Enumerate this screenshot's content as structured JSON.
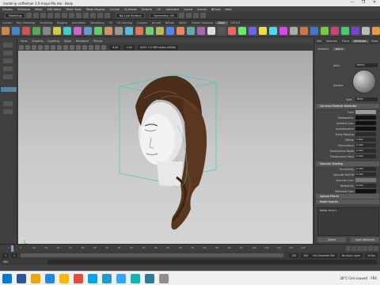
{
  "window": {
    "title": "model-ip coffeehair 2.0 maya file.mb - Body",
    "controls": [
      "—",
      "❐",
      "✕"
    ]
  },
  "menubar": [
    "Display",
    "Windows",
    "Mesh",
    "Edit Mesh",
    "Mesh Tools",
    "Mesh Display",
    "Curves",
    "Surfaces",
    "Deform",
    "UV",
    "Generate",
    "Cache",
    "Arnold",
    "Bifrost",
    "Help"
  ],
  "statusline": {
    "mode": "Modeling",
    "live_surface": "No Live Surface",
    "symmetry": "Symmetry: Off"
  },
  "shelf_tabs": [
    "Curves",
    "Poly Modeling",
    "Sculpting",
    "Rigging",
    "Animation",
    "Rendering",
    "FX",
    "FX Caching",
    "Custom",
    "Arnold",
    "Bifrost",
    "MASH",
    "Motion Graphics",
    "XGen",
    "TURTLE"
  ],
  "shelf_active": "XGen",
  "viewport": {
    "menu": [
      "View",
      "Shading",
      "Lighting",
      "Show",
      "Renderer",
      "Panels"
    ],
    "gamma": "sRGB gamma",
    "exposure": "0.00",
    "gamma_val": "1.00",
    "camera_label": "ACES 1.0 SDR-video (sRGB)"
  },
  "right_panel": {
    "tabs": [
      "Edit",
      "Selected",
      "Focus",
      "Attributes",
      "Show",
      "Help"
    ],
    "subtabs": [
      "lambert1",
      "blinn1"
    ],
    "material_label": "blinn:",
    "material_value": "blinn1",
    "sample_label": "Sample",
    "type_label": "Type",
    "type_value": "Blinn",
    "section_common": "Common Material Attributes",
    "attributes": [
      {
        "label": "Color",
        "kind": "color",
        "color": "#9a9a9a"
      },
      {
        "label": "Transparency",
        "kind": "color",
        "color": "#111111"
      },
      {
        "label": "Ambient Color",
        "kind": "color",
        "color": "#111111"
      },
      {
        "label": "Incandescence",
        "kind": "color",
        "color": "#111111"
      },
      {
        "label": "Bump Mapping",
        "kind": "value",
        "value": ""
      },
      {
        "label": "Diffuse",
        "kind": "value",
        "value": "0.800"
      },
      {
        "label": "Translucence",
        "kind": "value",
        "value": "0.000"
      },
      {
        "label": "Translucence Depth",
        "kind": "value",
        "value": "0.500"
      },
      {
        "label": "Translucence Focus",
        "kind": "value",
        "value": "0.500"
      }
    ],
    "section_specular": "Specular Shading",
    "specular": [
      {
        "label": "Eccentricity",
        "kind": "value",
        "value": "0.300"
      },
      {
        "label": "Specular Roll Off",
        "kind": "value",
        "value": "0.700"
      },
      {
        "label": "Specular Color",
        "kind": "color",
        "color": "#777777"
      },
      {
        "label": "Reflectivity",
        "kind": "value",
        "value": "0.500"
      },
      {
        "label": "Reflected Color",
        "kind": "color",
        "color": "#111111"
      }
    ],
    "collapsed_sections": [
      "Special Effects",
      "Matte Opacity"
    ],
    "notes_label": "Notes: blinn1",
    "buttons": [
      "Select",
      "Load Attributes"
    ]
  },
  "timeline": {
    "ticks": [
      "1",
      "5",
      "10",
      "15",
      "20",
      "25",
      "30",
      "35",
      "40",
      "45",
      "50",
      "55",
      "60",
      "65",
      "70",
      "75",
      "80",
      "85",
      "90",
      "95",
      "100",
      "105",
      "110",
      "115",
      "120"
    ]
  },
  "range": {
    "start": "1",
    "start2": "1",
    "end": "120",
    "end2": "200",
    "character_set": "No Character Set",
    "anim_layer": "No Anim Layer",
    "fps": "24 fps"
  },
  "command_line": {
    "label": "MEL"
  },
  "taskbar": {
    "weather": "30°C  Ciel couvert",
    "lang": "FRA",
    "time": "",
    "icon_colors": [
      "#0078d7",
      "#2b579a",
      "#f0a500",
      "#1e88e5",
      "#ffb900",
      "#e74c3c",
      "#00a4ef",
      "#1d9bd1",
      "#31a8ff",
      "#0db7b7",
      "#2d7d9a",
      "#8e8e8e"
    ]
  }
}
